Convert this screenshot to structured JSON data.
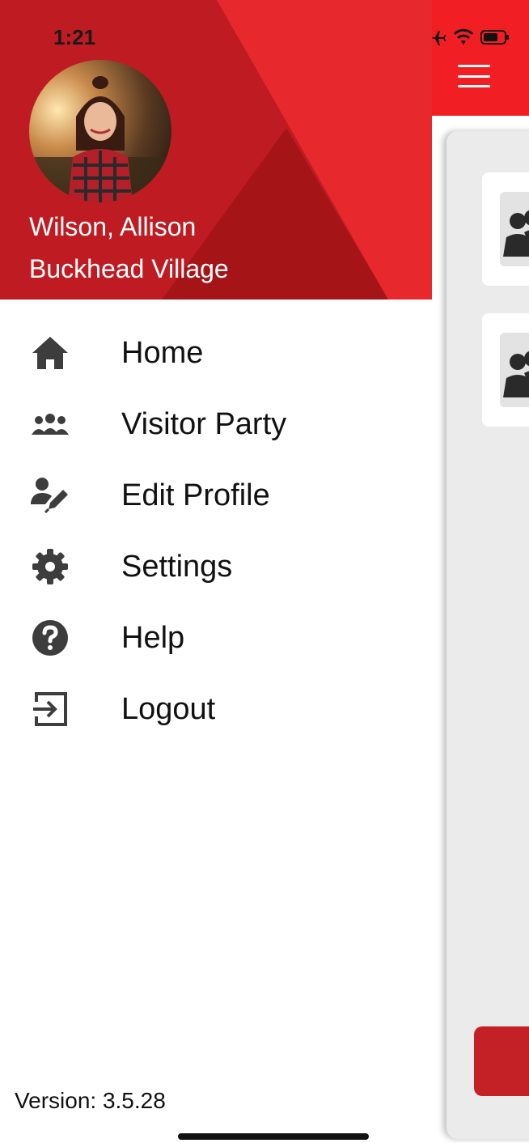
{
  "status_bar": {
    "time": "1:21"
  },
  "drawer": {
    "user_name": "Wilson, Allison",
    "user_location": "Buckhead Village",
    "menu": [
      {
        "label": "Home",
        "icon": "home-icon"
      },
      {
        "label": "Visitor Party",
        "icon": "group-icon"
      },
      {
        "label": "Edit Profile",
        "icon": "user-edit-icon"
      },
      {
        "label": "Settings",
        "icon": "gear-icon"
      },
      {
        "label": "Help",
        "icon": "question-circle-icon"
      },
      {
        "label": "Logout",
        "icon": "logout-icon"
      }
    ],
    "version": "Version: 3.5.28"
  },
  "colors": {
    "brand_red": "#f11e24",
    "header_red": "#be1c22",
    "icon_gray": "#3d3d3d"
  }
}
